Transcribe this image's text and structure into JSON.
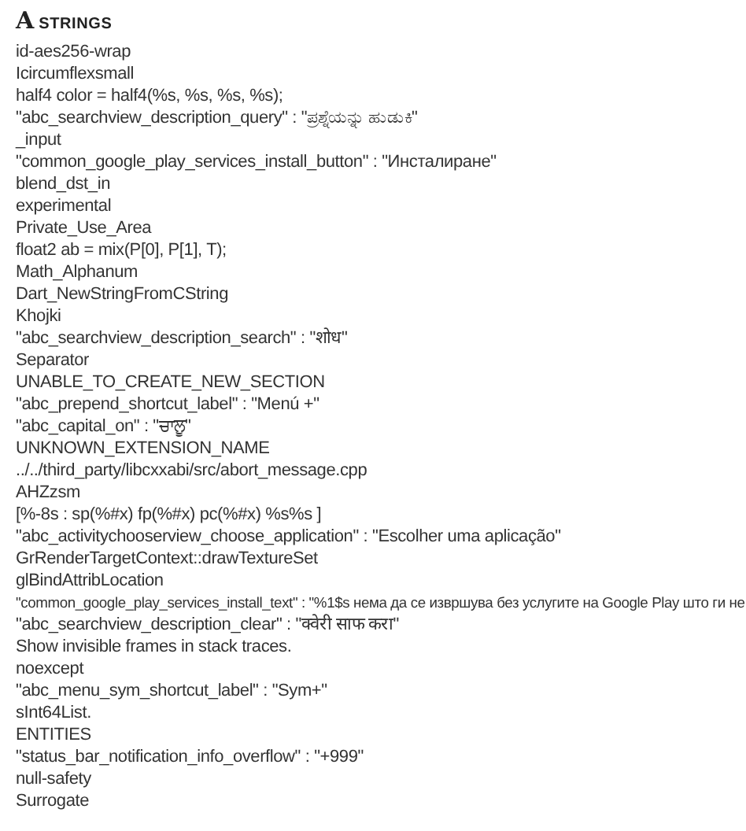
{
  "section": {
    "glyph": "A",
    "title": "STRINGS"
  },
  "strings": [
    "id-aes256-wrap",
    "Icircumflexsmall",
    "half4 color = half4(%s, %s, %s, %s);",
    "\"abc_searchview_description_query\" : \"ಪ್ರಶ್ನೆಯನ್ನು ಹುಡುಕಿ\"",
    "_input",
    "\"common_google_play_services_install_button\" : \"Инсталиране\"",
    "blend_dst_in",
    "experimental",
    "Private_Use_Area",
    "float2 ab = mix(P[0], P[1], T);",
    "Math_Alphanum",
    "Dart_NewStringFromCString",
    "Khojki",
    "\"abc_searchview_description_search\" : \"शोध\"",
    "Separator",
    "UNABLE_TO_CREATE_NEW_SECTION",
    "\"abc_prepend_shortcut_label\" : \"Menú +\"",
    "\"abc_capital_on\" : \"ਚਾਲੂ\"",
    "UNKNOWN_EXTENSION_NAME",
    "../../third_party/libcxxabi/src/abort_message.cpp",
    "AHZzsm",
    "[%-8s : sp(%#x) fp(%#x) pc(%#x) %s%s ]",
    "\"abc_activitychooserview_choose_application\" : \"Escolher uma aplicação\"",
    "GrRenderTargetContext::drawTextureSet",
    "glBindAttribLocation",
    "\"common_google_play_services_install_text\" : \"%1$s нема да се извршува без услугите на Google Play што ги не",
    "\"abc_searchview_description_clear\" : \"क्वेरी साफ करा\"",
    "Show invisible frames in stack traces.",
    "noexcept",
    "\"abc_menu_sym_shortcut_label\" : \"Sym+\"",
    "sInt64List.",
    "ENTITIES",
    "\"status_bar_notification_info_overflow\" : \"+999\"",
    "null-safety",
    "Surrogate"
  ]
}
